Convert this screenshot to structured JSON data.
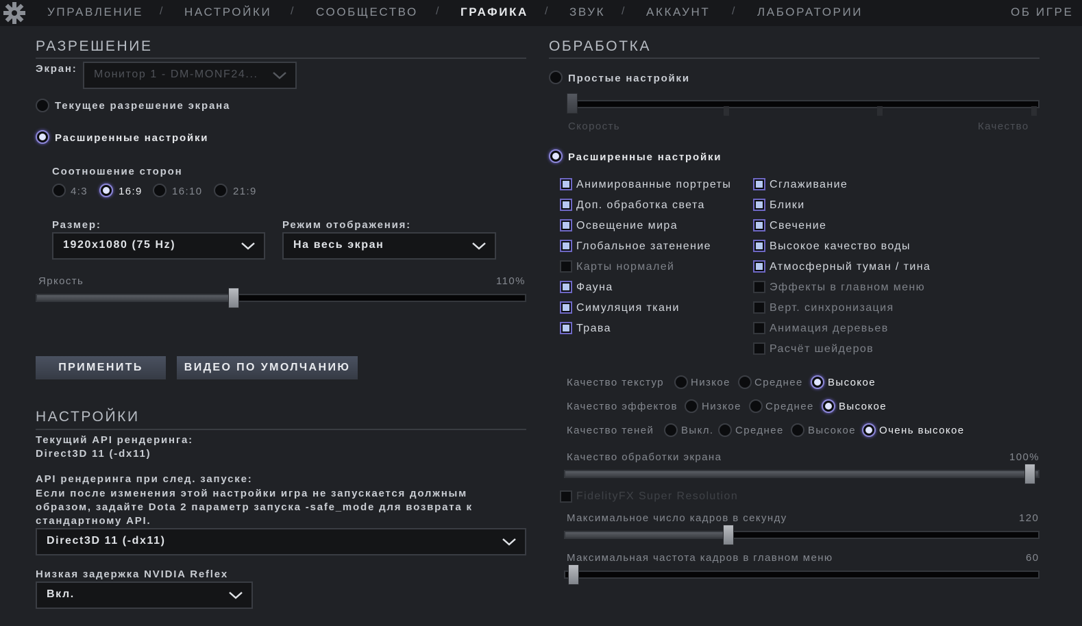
{
  "nav": {
    "items": [
      "УПРАВЛЕНИЕ",
      "НАСТРОЙКИ",
      "СООБЩЕСТВО",
      "ГРАФИКА",
      "ЗВУК",
      "АККАУНТ",
      "ЛАБОРАТОРИИ"
    ],
    "active": "ГРАФИКА",
    "about": "ОБ ИГРЕ",
    "separator": "/"
  },
  "resolution": {
    "title": "РАЗРЕШЕНИЕ",
    "screen_label": "Экран:",
    "screen_value": "Монитор 1 - DM-MONF24...",
    "current_res_label": "Текущее разрешение экрана",
    "advanced_label": "Расширенные настройки",
    "aspect_label": "Соотношение сторон",
    "aspect_options": [
      "4:3",
      "16:9",
      "16:10",
      "21:9"
    ],
    "aspect_selected": "16:9",
    "size_label": "Размер:",
    "size_value": "1920x1080 (75 Hz)",
    "display_mode_label": "Режим отображения:",
    "display_mode_value": "На весь экран",
    "brightness_label": "Яркость",
    "brightness_value": "110%",
    "brightness_level": 0.4,
    "apply_button": "ПРИМЕНИТЬ",
    "default_button": "ВИДЕО ПО УМОЛЧАНИЮ"
  },
  "settings": {
    "title": "НАСТРОЙКИ",
    "current_api_label": "Текущий API рендеринга:",
    "current_api_value": "Direct3D 11 (-dx11)",
    "next_api_label": "API рендеринга при след. запуске:",
    "next_api_note_1": "Если после изменения этой настройки игра не запускается должным",
    "next_api_note_2": "образом, задайте Dota 2 параметр запуска -safe_mode для возврата к",
    "next_api_note_3": "стандартному API.",
    "api_select_value": "Direct3D 11 (-dx11)",
    "reflex_label": "Низкая задержка NVIDIA Reflex",
    "reflex_value": "Вкл."
  },
  "processing": {
    "title": "ОБРАБОТКА",
    "simple_label": "Простые настройки",
    "speed_label": "Скорость",
    "quality_label": "Качество",
    "advanced_label": "Расширенные настройки",
    "checks_left": [
      {
        "label": "Анимированные портреты",
        "on": true
      },
      {
        "label": "Доп. обработка света",
        "on": true
      },
      {
        "label": "Освещение мира",
        "on": true
      },
      {
        "label": "Глобальное затенение",
        "on": true
      },
      {
        "label": "Карты нормалей",
        "on": false
      },
      {
        "label": "Фауна",
        "on": true
      },
      {
        "label": "Симуляция ткани",
        "on": true
      },
      {
        "label": "Трава",
        "on": true
      }
    ],
    "checks_right": [
      {
        "label": "Сглаживание",
        "on": true
      },
      {
        "label": "Блики",
        "on": true
      },
      {
        "label": "Свечение",
        "on": true
      },
      {
        "label": "Высокое качество воды",
        "on": true
      },
      {
        "label": "Атмосферный туман / тина",
        "on": true
      },
      {
        "label": "Эффекты в главном меню",
        "on": false
      },
      {
        "label": "Верт. синхронизация",
        "on": false
      },
      {
        "label": "Анимация деревьев",
        "on": false
      },
      {
        "label": "Расчёт шейдеров",
        "on": false
      }
    ],
    "texture_label": "Качество текстур",
    "texture_options": [
      "Низкое",
      "Среднее",
      "Высокое"
    ],
    "texture_selected": "Высокое",
    "effects_label": "Качество эффектов",
    "effects_options": [
      "Низкое",
      "Среднее",
      "Высокое"
    ],
    "effects_selected": "Высокое",
    "shadows_label": "Качество теней",
    "shadows_options": [
      "Выкл.",
      "Среднее",
      "Высокое",
      "Очень высокое"
    ],
    "shadows_selected": "Очень высокое",
    "screen_quality_label": "Качество обработки экрана",
    "screen_quality_value": "100%",
    "screen_quality_level": 1.0,
    "fsr_label": "FidelityFX Super Resolution",
    "max_fps_label": "Максимальное число кадров в секунду",
    "max_fps_value": "120",
    "max_fps_level": 0.34,
    "menu_fps_label": "Максимальная частота кадров в главном меню",
    "menu_fps_value": "60",
    "menu_fps_level": 0.0
  }
}
